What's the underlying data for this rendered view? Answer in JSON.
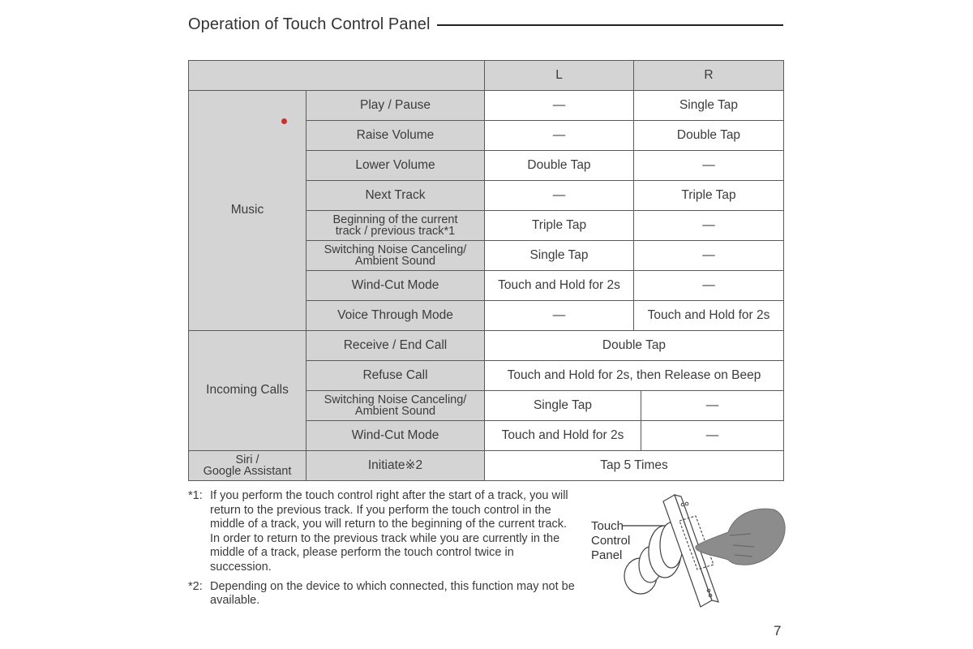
{
  "header": {
    "title": "Operation of Touch Control Panel"
  },
  "table": {
    "columns": [
      "",
      "L",
      "R"
    ],
    "groups": [
      {
        "label": "Music",
        "rows": [
          {
            "function": "Play / Pause",
            "L": "—",
            "R": "Single Tap"
          },
          {
            "function": "Raise Volume",
            "L": "—",
            "R": "Double Tap"
          },
          {
            "function": "Lower Volume",
            "L": "Double Tap",
            "R": "—"
          },
          {
            "function": "Next Track",
            "L": "—",
            "R": "Triple Tap"
          },
          {
            "function_line1": "Beginning of the current",
            "function_line2": "track / previous track*1",
            "L": "Triple Tap",
            "R": "—"
          },
          {
            "function_line1": "Switching Noise Canceling/",
            "function_line2": "Ambient Sound",
            "L": "Single Tap",
            "R": "—"
          },
          {
            "function": "Wind-Cut Mode",
            "L": "Touch and Hold for 2s",
            "R": "—"
          },
          {
            "function": "Voice Through Mode",
            "L": "—",
            "R": "Touch and Hold for 2s"
          }
        ]
      },
      {
        "label": "Incoming Calls",
        "rows": [
          {
            "function": "Receive / End Call",
            "both": "Double Tap"
          },
          {
            "function": "Refuse Call",
            "both": "Touch and Hold for 2s, then Release on Beep"
          },
          {
            "function_line1": "Switching Noise Canceling/",
            "function_line2": "Ambient Sound",
            "L": "Single Tap",
            "R": "—"
          },
          {
            "function": "Wind-Cut Mode",
            "L": "Touch and Hold for 2s",
            "R": "—"
          }
        ]
      },
      {
        "label_line1": "Siri /",
        "label_line2": "Google Assistant",
        "rows": [
          {
            "function": "Initiate※2",
            "both": "Tap 5 Times"
          }
        ]
      }
    ]
  },
  "footnotes": [
    {
      "mark": "*1:",
      "text": "If you perform the touch control right after the start of a track, you will return to the previous track. If you perform the touch control in the middle of a track, you will return to the beginning of the current track. In order to return to the previous track while you are currently in the middle of a track, please perform the touch control twice in succession."
    },
    {
      "mark": "*2:",
      "text": "Depending on the device to which connected, this function may not be available."
    }
  ],
  "illustration": {
    "label_line1": "Touch",
    "label_line2": "Control",
    "label_line3": "Panel",
    "icon": "earbud-touch-finger-icon"
  },
  "page_number": "7",
  "colors": {
    "header_fill": "#d4d4d4",
    "border": "#5a5a5a",
    "marker_dot": "#c9302c"
  }
}
